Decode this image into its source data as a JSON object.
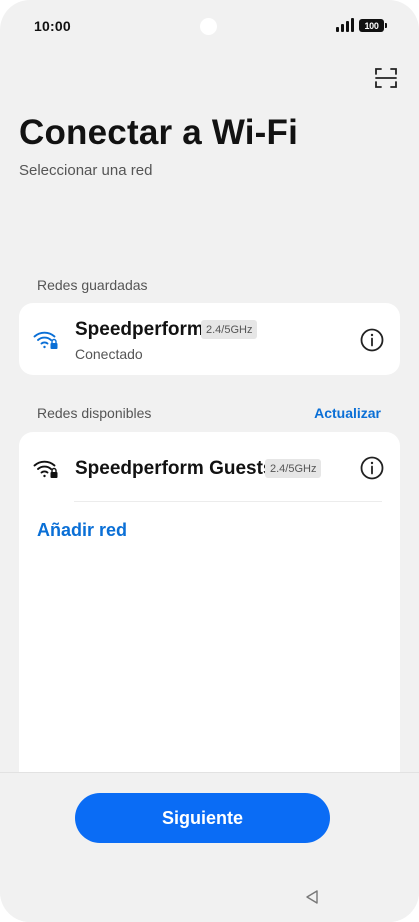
{
  "status_bar": {
    "time": "10:00",
    "battery": "100"
  },
  "header": {
    "title": "Conectar a Wi-Fi",
    "subtitle": "Seleccionar una red",
    "scan_icon": "qr-scan-icon"
  },
  "saved": {
    "label": "Redes guardadas",
    "networks": [
      {
        "name": "Speedperform",
        "band": "2.4/5GHz",
        "status": "Conectado",
        "icon": "wifi-lock-icon",
        "color": "#0a6fd6"
      }
    ]
  },
  "available": {
    "label": "Redes disponibles",
    "refresh_label": "Actualizar",
    "networks": [
      {
        "name": "Speedperform Guests",
        "band": "2.4/5GHz",
        "icon": "wifi-lock-icon"
      }
    ],
    "add_label": "Añadir red"
  },
  "footer": {
    "next_label": "Siguiente",
    "back_icon": "back-triangle-icon"
  },
  "colors": {
    "accent": "#0a6cf5",
    "link": "#0a6fd6",
    "background": "#f1f1f1",
    "card": "#ffffff"
  }
}
